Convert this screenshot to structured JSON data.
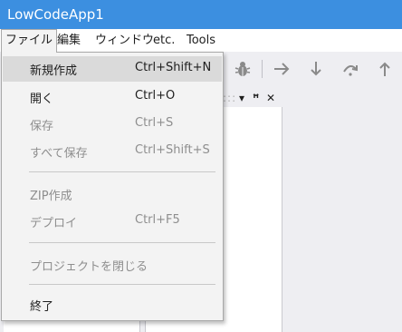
{
  "window": {
    "title": "LowCodeApp1"
  },
  "menubar": {
    "items": [
      "ファイル",
      "編集",
      "ウィンドウ",
      "etc.",
      "Tools"
    ]
  },
  "file_menu": {
    "items": [
      {
        "label": "新規作成",
        "shortcut": "Ctrl+Shift+N",
        "enabled": true,
        "highlighted": true
      },
      {
        "label": "開く",
        "shortcut": "Ctrl+O",
        "enabled": true
      },
      {
        "label": "保存",
        "shortcut": "Ctrl+S",
        "enabled": false
      },
      {
        "label": "すべて保存",
        "shortcut": "Ctrl+Shift+S",
        "enabled": false
      },
      {
        "label": "ZIP作成",
        "shortcut": "",
        "enabled": false
      },
      {
        "label": "デプロイ",
        "shortcut": "Ctrl+F5",
        "enabled": false
      },
      {
        "label": "プロジェクトを閉じる",
        "shortcut": "",
        "enabled": false
      },
      {
        "label": "終了",
        "shortcut": "",
        "enabled": true
      }
    ]
  },
  "toolbar": {
    "icons": [
      "bug-icon",
      "step-forward-icon",
      "step-into-icon",
      "step-over-icon",
      "step-out-icon"
    ]
  },
  "panel": {
    "pin_glyph": "ꟸ",
    "close_glyph": "✕",
    "dropdown_glyph": "▾"
  },
  "colors": {
    "titlebar": "#3c8fe0",
    "menu_hover": "#dadada",
    "disabled_text": "#8e8e8e"
  }
}
